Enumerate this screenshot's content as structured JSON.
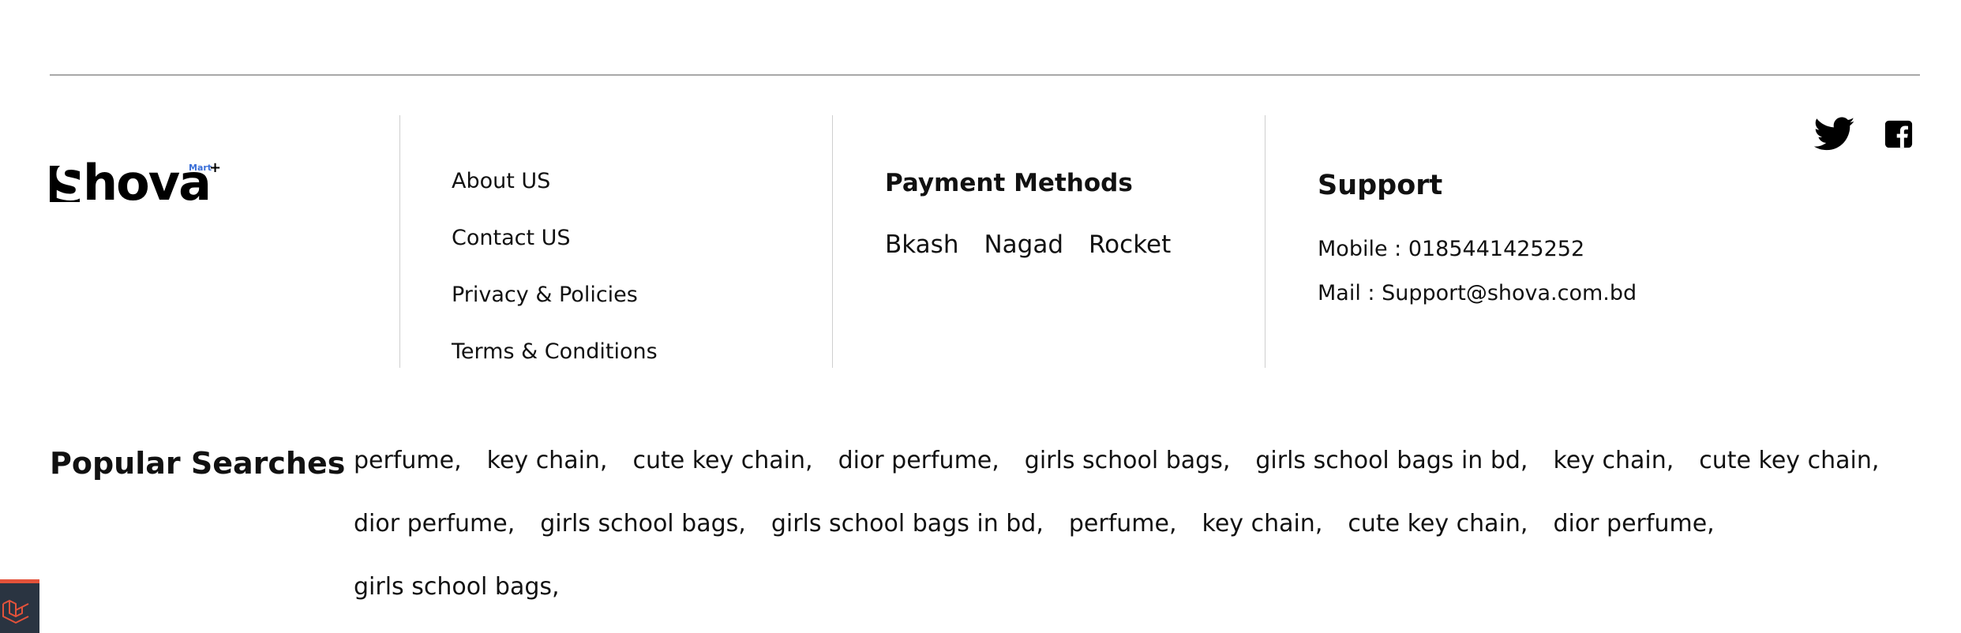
{
  "brand": {
    "name_first": "S",
    "name_rest": "hova",
    "sub": "Mart",
    "plus": "+"
  },
  "links": [
    {
      "label": "About US"
    },
    {
      "label": "Contact US"
    },
    {
      "label": "Privacy & Policies"
    },
    {
      "label": "Terms & Conditions"
    }
  ],
  "payment": {
    "title": "Payment Methods",
    "methods": [
      "Bkash",
      "Nagad",
      "Rocket"
    ]
  },
  "support": {
    "title": "Support",
    "mobile": "Mobile : 0185441425252",
    "mail": "Mail : Support@shova.com.bd"
  },
  "social": {
    "twitter_icon": "twitter-icon",
    "facebook_icon": "facebook-icon"
  },
  "popular": {
    "title": "Popular Searches",
    "tags": [
      "perfume,",
      "key chain,",
      "cute key chain,",
      "dior perfume,",
      "girls school bags,",
      "girls school bags in bd,",
      "key chain,",
      "cute key chain,",
      "dior perfume,",
      "girls school bags,",
      "girls school bags in bd,",
      "perfume,",
      "key chain,",
      "cute key chain,",
      "dior perfume,",
      "girls school bags,"
    ]
  },
  "colors": {
    "text": "#111111",
    "divider": "#cfcfcf",
    "rule": "#a8a8a8",
    "mart_blue": "#3b6fd8",
    "widget_bg": "#2a3441",
    "widget_accent": "#e3523a"
  },
  "widget": {
    "icon": "laravel-debugbar-icon"
  }
}
